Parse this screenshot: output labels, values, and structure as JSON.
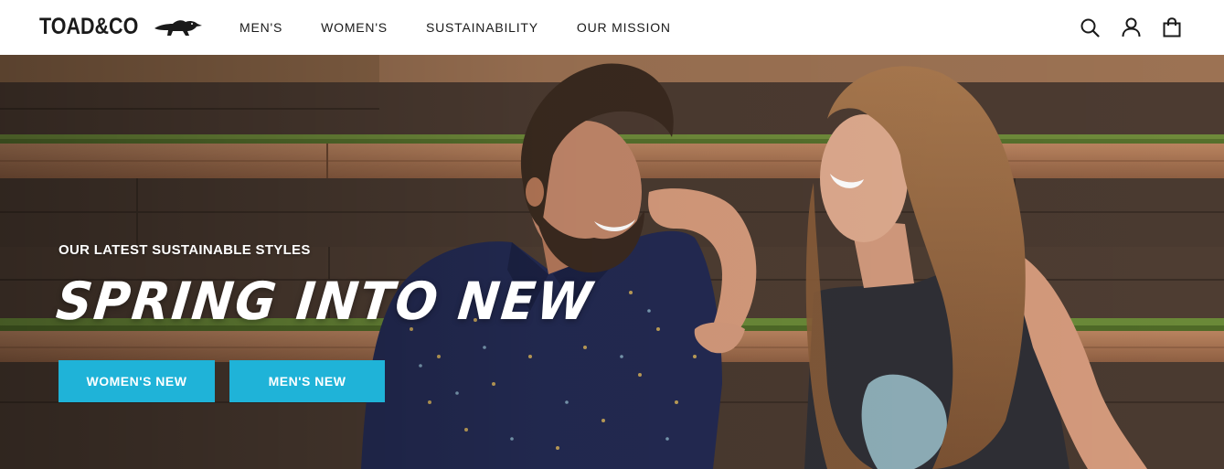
{
  "header": {
    "logo_text": "TOAD&CO",
    "logo_icon": "toad-icon",
    "nav": [
      {
        "label": "MEN'S"
      },
      {
        "label": "WOMEN'S"
      },
      {
        "label": "SUSTAINABILITY"
      },
      {
        "label": "OUR MISSION"
      }
    ],
    "icons": [
      "search-icon",
      "account-icon",
      "bag-icon"
    ]
  },
  "hero": {
    "eyebrow": "OUR LATEST SUSTAINABLE STYLES",
    "title": "SPRING INTO NEW",
    "buttons": [
      {
        "label": "WOMEN'S NEW"
      },
      {
        "label": "MEN'S NEW"
      }
    ]
  },
  "colors": {
    "button_bg": "#1fb3d8",
    "text_dark": "#1a1a1a",
    "header_bg": "#ffffff"
  }
}
